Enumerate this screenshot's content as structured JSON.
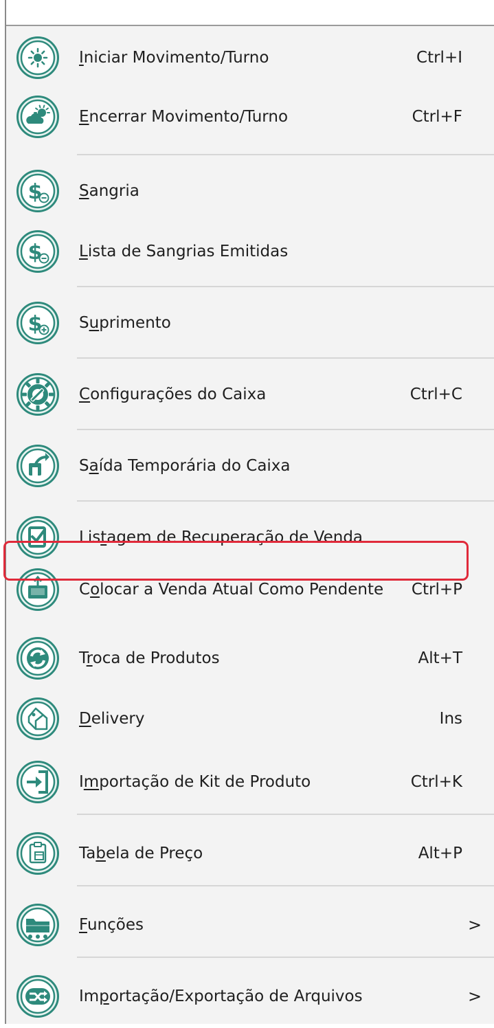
{
  "menu": {
    "items": [
      {
        "pre": "",
        "ul": "I",
        "post": "niciar Movimento/Turno",
        "shortcut": "Ctrl+I",
        "icon": "sun-icon"
      },
      {
        "pre": "",
        "ul": "E",
        "post": "ncerrar Movimento/Turno",
        "shortcut": "Ctrl+F",
        "icon": "partly-cloudy-icon"
      },
      {
        "pre": "",
        "ul": "S",
        "post": "angria",
        "shortcut": "",
        "icon": "money-minus-icon"
      },
      {
        "pre": "",
        "ul": "L",
        "post": "ista de Sangrias Emitidas",
        "shortcut": "",
        "icon": "money-minus-icon"
      },
      {
        "pre": "S",
        "ul": "u",
        "post": "primento",
        "shortcut": "",
        "icon": "money-plus-icon"
      },
      {
        "pre": "",
        "ul": "C",
        "post": "onfigurações do Caixa",
        "shortcut": "Ctrl+C",
        "icon": "gear-wrench-icon"
      },
      {
        "pre": "S",
        "ul": "a",
        "post": "ída Temporária do Caixa",
        "shortcut": "",
        "icon": "exit-arrow-icon"
      },
      {
        "pre": "Lis",
        "ul": "t",
        "post": "agem de Recuperação de Venda",
        "shortcut": "",
        "icon": "checklist-icon"
      },
      {
        "pre": "C",
        "ul": "o",
        "post": "locar a Venda Atual Como Pendente",
        "shortcut": "Ctrl+P",
        "icon": "pending-tray-icon"
      },
      {
        "pre": "T",
        "ul": "r",
        "post": "oca de Produtos",
        "shortcut": "Alt+T",
        "icon": "exchange-icon"
      },
      {
        "pre": "",
        "ul": "D",
        "post": "elivery",
        "shortcut": "Ins",
        "icon": "delivery-tag-icon"
      },
      {
        "pre": "I",
        "ul": "m",
        "post": "portação de Kit de Produto",
        "shortcut": "Ctrl+K",
        "icon": "import-icon"
      },
      {
        "pre": "Ta",
        "ul": "b",
        "post": "ela de Preço",
        "shortcut": "Alt+P",
        "icon": "price-table-icon"
      },
      {
        "pre": "",
        "ul": "F",
        "post": "unções",
        "shortcut": "",
        "arrow": ">",
        "icon": "folder-cart-icon"
      },
      {
        "pre": "Im",
        "ul": "p",
        "post": "ortação/Exportação de Arquivos",
        "shortcut": "",
        "arrow": ">",
        "icon": "shuffle-icon"
      }
    ],
    "highlighted_index": 8
  },
  "colors": {
    "icon_teal": "#2e8a7c",
    "icon_fill": "#e7f3f0",
    "menu_background": "#f3f3f3",
    "separator": "#d6d6d6",
    "highlight_border": "#e02a3a"
  }
}
